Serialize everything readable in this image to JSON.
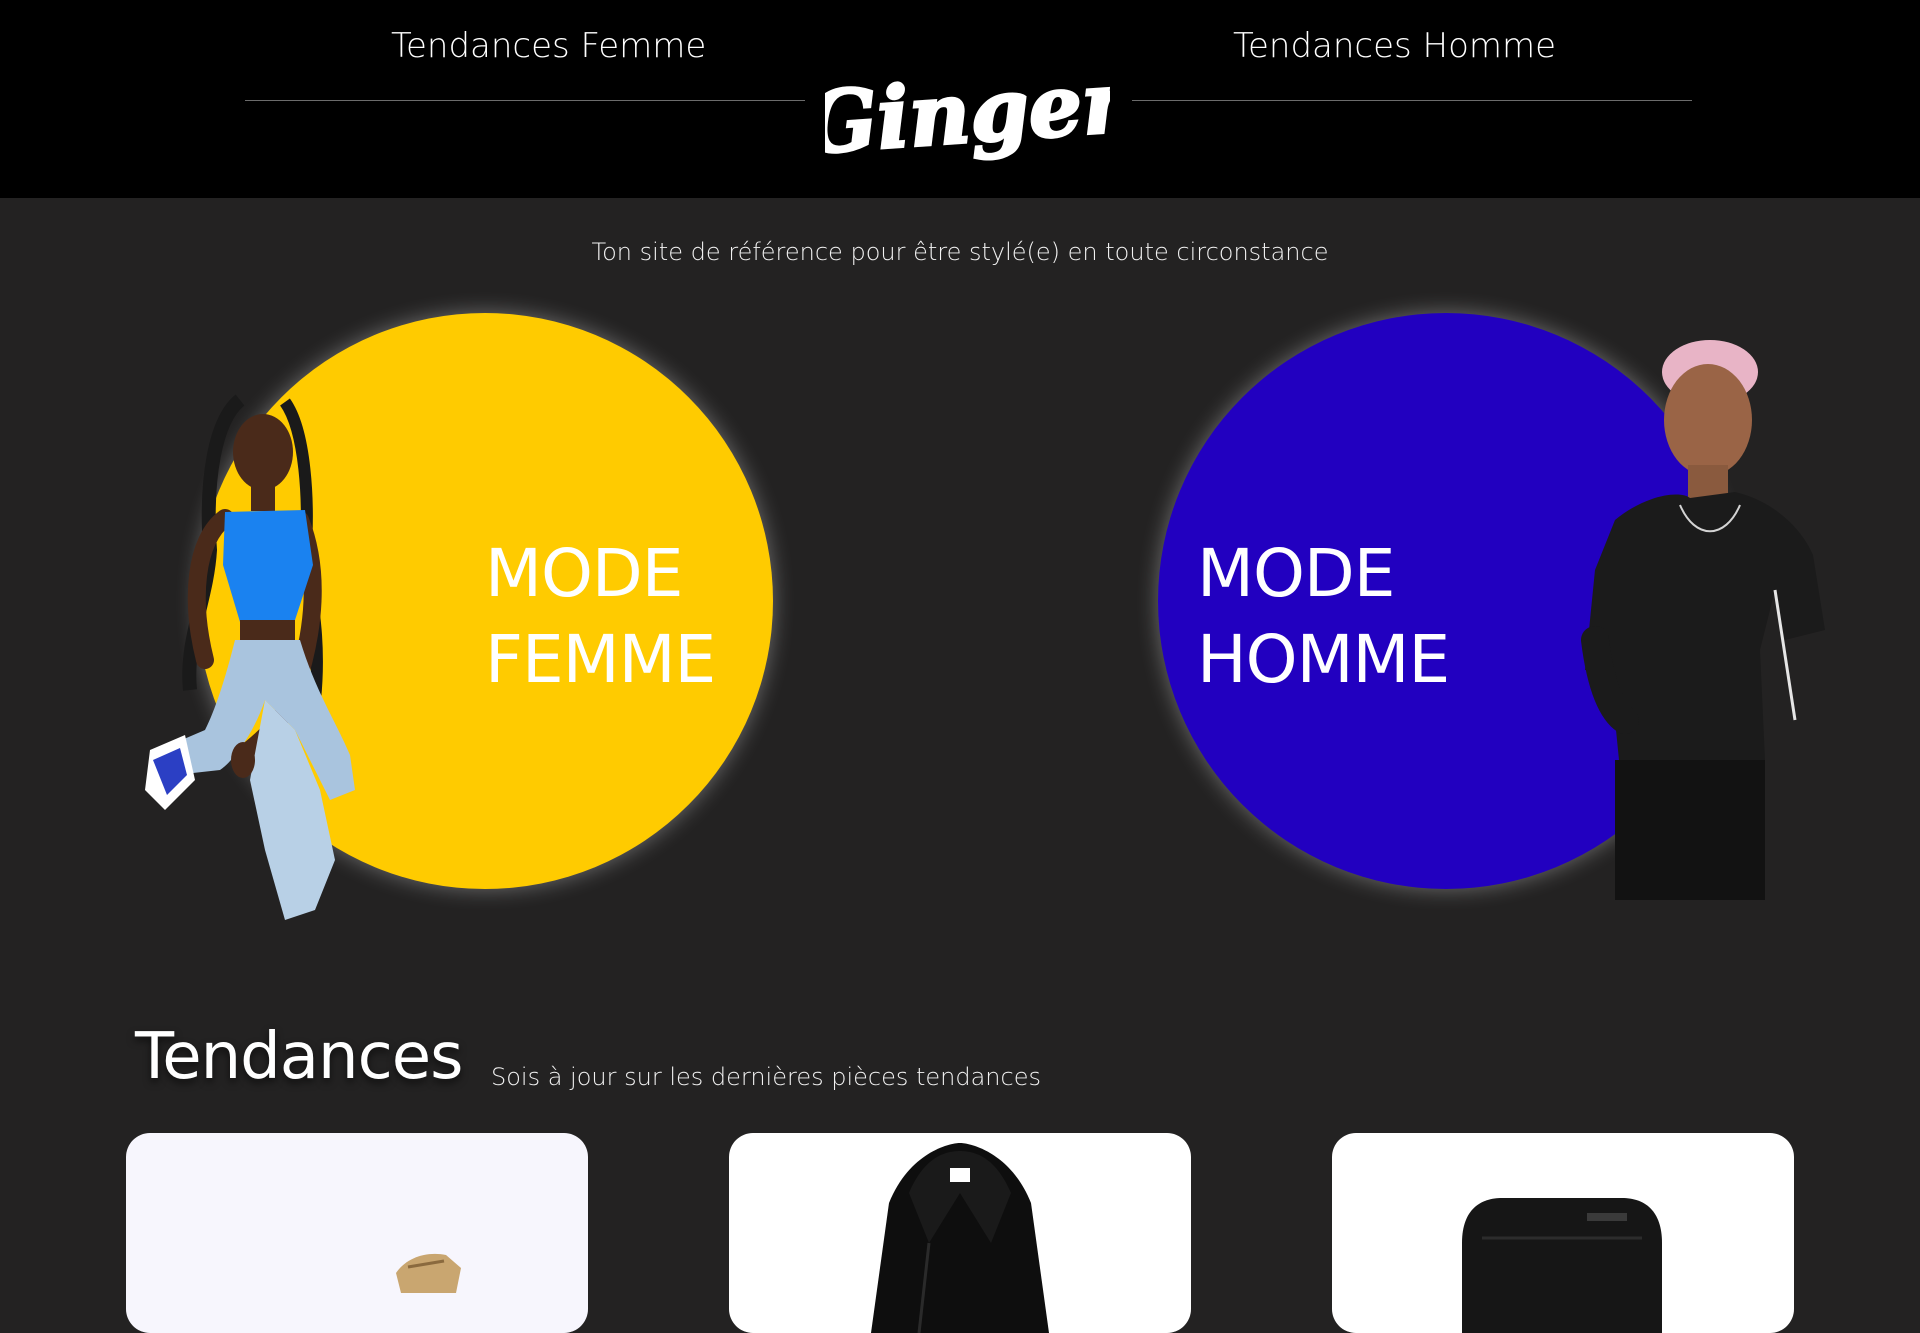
{
  "header": {
    "nav_left": "Tendances Femme",
    "nav_right": "Tendances Homme",
    "logo_text": "Ginger"
  },
  "tagline": "Ton site de référence pour être stylé(e) en toute circonstance",
  "categories": [
    {
      "label": "MODE\nFEMME",
      "color": "#ffcb00"
    },
    {
      "label": "MODE\nHOMME",
      "color": "#2200c0"
    }
  ],
  "trends": {
    "title": "Tendances",
    "subtitle": "Sois à jour sur les dernières pièces tendances",
    "cards": [
      {
        "item": "shoe"
      },
      {
        "item": "jacket"
      },
      {
        "item": "bag"
      }
    ]
  },
  "colors": {
    "header_bg": "#000000",
    "page_bg": "#232222",
    "femme_accent": "#ffcb00",
    "homme_accent": "#2200c0"
  }
}
